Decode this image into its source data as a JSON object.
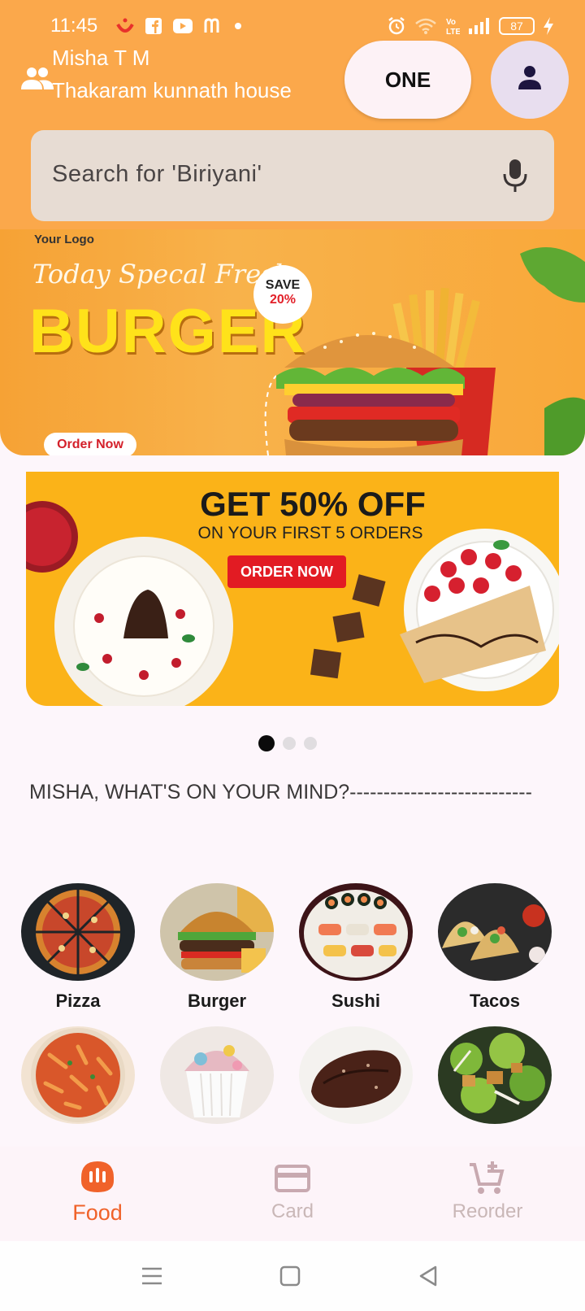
{
  "status_bar": {
    "time": "11:45",
    "battery": "87",
    "icons_left": [
      "swiggy-icon",
      "facebook-icon",
      "youtube-icon",
      "m-icon",
      "dot-icon"
    ],
    "icons_right": [
      "alarm-icon",
      "wifi-icon",
      "volte-icon",
      "signal-icon",
      "battery-icon",
      "charging-icon"
    ]
  },
  "address": {
    "name": "Misha T M",
    "line": "Thakaram kunnath house"
  },
  "header": {
    "one_label": "ONE"
  },
  "search": {
    "placeholder": "Search for 'Biriyani'"
  },
  "banners": [
    {
      "logo": "Your Logo",
      "script": "Today Specal Fresh",
      "title": "BURGER",
      "save_label": "SAVE",
      "save_value": "20%",
      "cta": "Order Now"
    },
    {
      "headline": "GET 50% OFF",
      "sub": "ON YOUR FIRST 5 ORDERS",
      "cta": "ORDER NOW"
    }
  ],
  "carousel": {
    "count": 3,
    "active": 0
  },
  "mind_heading": "MISHA,  WHAT'S ON YOUR MIND?---------------------------",
  "categories": [
    {
      "label": "Pizza",
      "icon": "pizza-image"
    },
    {
      "label": "Burger",
      "icon": "burger-image"
    },
    {
      "label": "Sushi",
      "icon": "sushi-image"
    },
    {
      "label": "Tacos",
      "icon": "tacos-image"
    },
    {
      "label": "",
      "icon": "pasta-image"
    },
    {
      "label": "",
      "icon": "cupcake-image"
    },
    {
      "label": "",
      "icon": "steak-image"
    },
    {
      "label": "",
      "icon": "salad-image"
    }
  ],
  "bottom_nav": [
    {
      "label": "Food",
      "icon": "food-icon",
      "active": true
    },
    {
      "label": "Card",
      "icon": "card-icon",
      "active": false
    },
    {
      "label": "Reorder",
      "icon": "reorder-cart-icon",
      "active": false
    }
  ],
  "colors": {
    "header": "#fba84b",
    "accent": "#f0622a",
    "search_bg": "#e7dcd3",
    "page_bg": "#fdf6fb"
  }
}
